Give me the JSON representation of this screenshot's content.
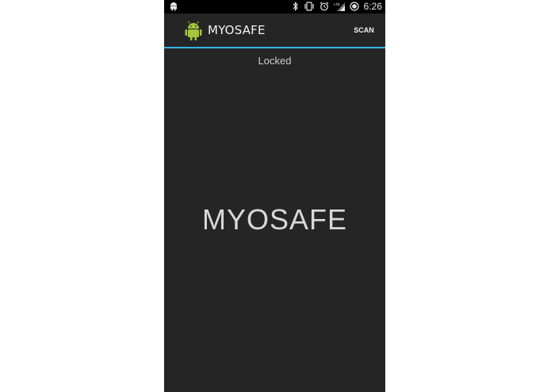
{
  "status_bar": {
    "time": "6:26",
    "icons": [
      "android-notification-icon",
      "bluetooth-icon",
      "vibrate-icon",
      "alarm-icon",
      "lte-signal-icon",
      "battery-icon"
    ]
  },
  "action_bar": {
    "title": "MYOSAFE",
    "scan_label": "SCAN",
    "accent_color": "#33b5e5"
  },
  "main": {
    "status": "Locked",
    "heading": "MYOSAFE"
  }
}
